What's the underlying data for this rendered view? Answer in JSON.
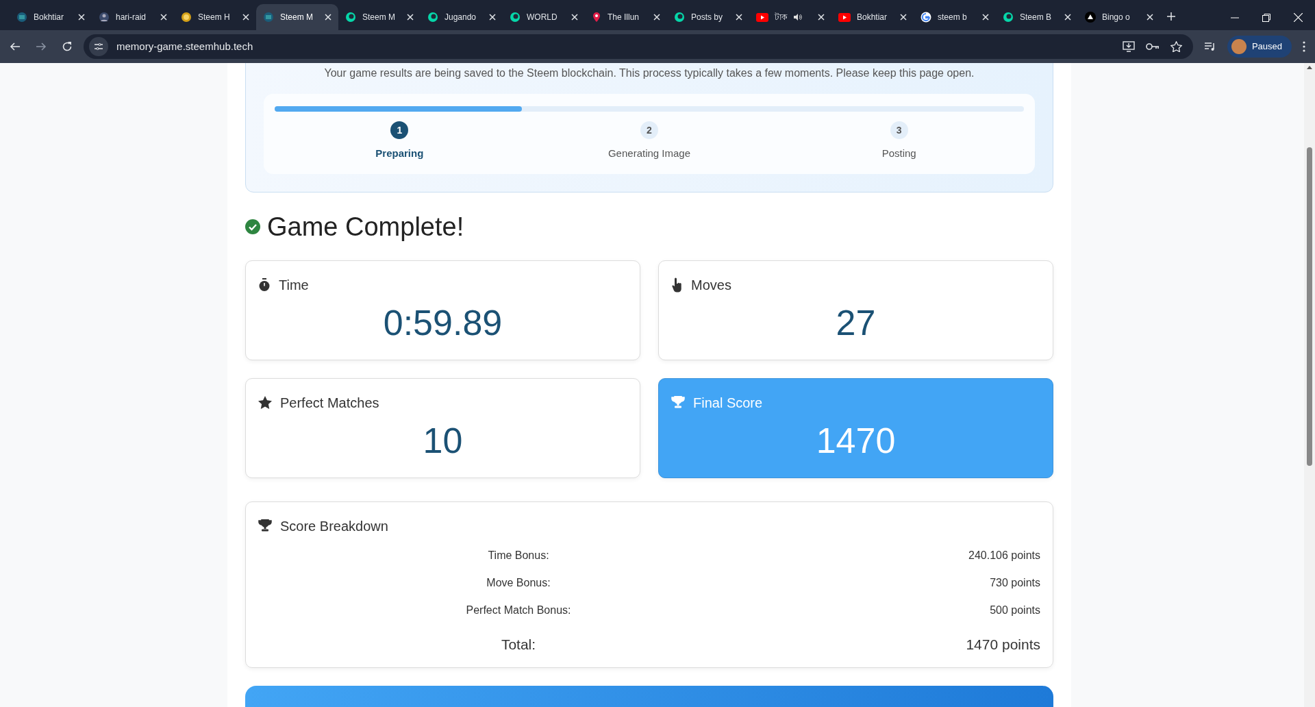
{
  "browser": {
    "tabs": [
      {
        "title": "Bokhtiar",
        "selected": false,
        "kind": "round",
        "audio": false
      },
      {
        "title": "hari-raid",
        "selected": false,
        "kind": "avatar",
        "audio": false
      },
      {
        "title": "Steem H",
        "selected": false,
        "kind": "coin",
        "audio": false
      },
      {
        "title": "Steem M",
        "selected": true,
        "kind": "round",
        "audio": false
      },
      {
        "title": "Steem M",
        "selected": false,
        "kind": "bubble",
        "audio": false
      },
      {
        "title": "Jugando",
        "selected": false,
        "kind": "bubble",
        "audio": false
      },
      {
        "title": "WORLD",
        "selected": false,
        "kind": "bubble",
        "audio": false
      },
      {
        "title": "The Illun",
        "selected": false,
        "kind": "pin",
        "audio": false
      },
      {
        "title": "Posts by",
        "selected": false,
        "kind": "bubble",
        "audio": false
      },
      {
        "title": "টাক",
        "selected": false,
        "kind": "video",
        "audio": true
      },
      {
        "title": "Bokhtiar",
        "selected": false,
        "kind": "video",
        "audio": false
      },
      {
        "title": "steem b",
        "selected": false,
        "kind": "search",
        "audio": false
      },
      {
        "title": "Steem B",
        "selected": false,
        "kind": "bubble",
        "audio": false
      },
      {
        "title": "Bingo o",
        "selected": false,
        "kind": "triangle",
        "audio": false
      }
    ],
    "url": "memory-game.steemhub.tech",
    "profile": "Paused"
  },
  "saving_panel": {
    "message": "Your game results are being saved to the Steem blockchain. This process typically takes a few moments. Please keep this page open.",
    "level": 0.33,
    "steps": [
      {
        "number": "1",
        "label": "Preparing",
        "selected": true
      },
      {
        "number": "2",
        "label": "Generating Image",
        "selected": false
      },
      {
        "number": "3",
        "label": "Posting",
        "selected": false
      }
    ]
  },
  "heading": "Game Complete!",
  "stats": [
    {
      "kind": "time",
      "label": "Time",
      "value": "0:59.89",
      "highlighted": false
    },
    {
      "kind": "moves",
      "label": "Moves",
      "value": "27",
      "highlighted": false
    },
    {
      "kind": "perfect",
      "label": "Perfect Matches",
      "value": "10",
      "highlighted": false
    },
    {
      "kind": "score",
      "label": "Final Score",
      "value": "1470",
      "highlighted": true
    }
  ],
  "breakdown": {
    "title": "Score Breakdown",
    "rows": [
      {
        "label": "Time Bonus:",
        "value": "240.106 points",
        "total": false
      },
      {
        "label": "Move Bonus:",
        "value": "730 points",
        "total": false
      },
      {
        "label": "Perfect Match Bonus:",
        "value": "500 points",
        "total": false
      },
      {
        "label": "Total:",
        "value": "1470 points",
        "total": true
      }
    ]
  }
}
